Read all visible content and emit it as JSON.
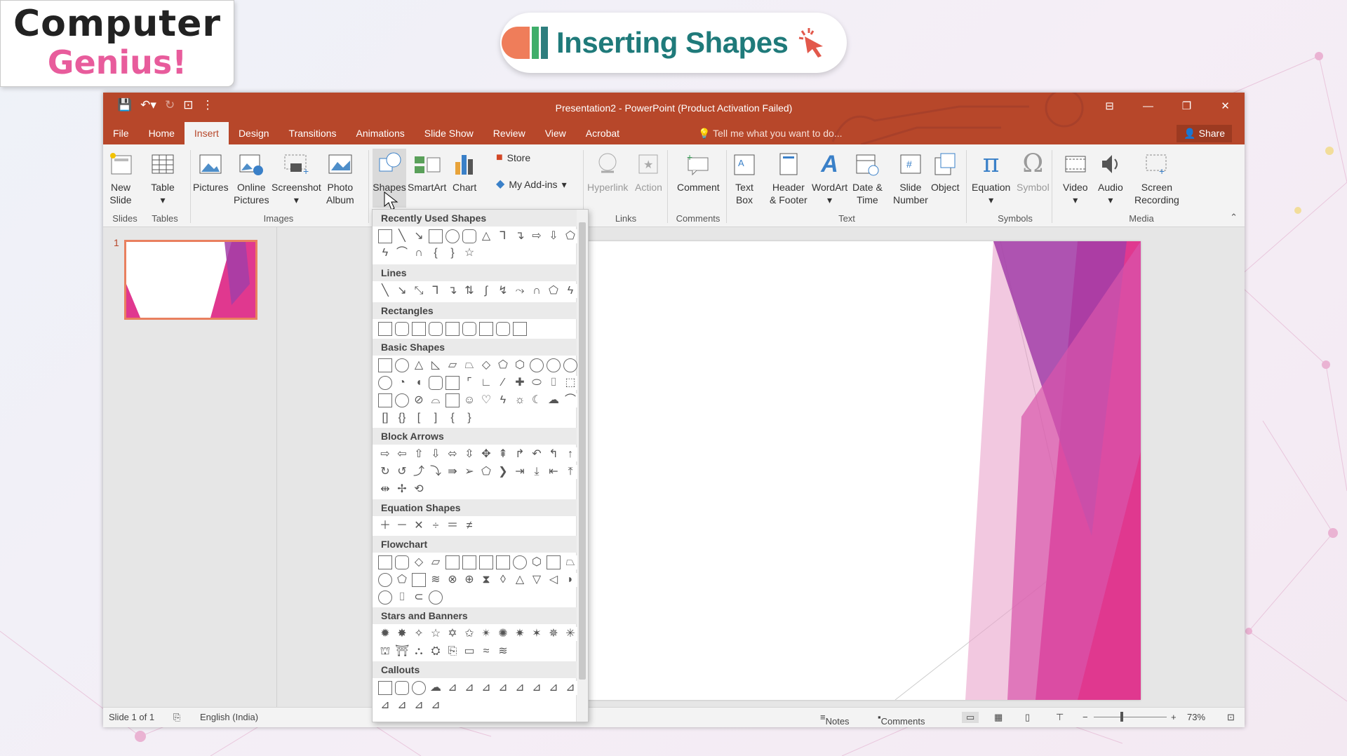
{
  "brand": {
    "line1": "Computer",
    "line2": "Genius!"
  },
  "banner": {
    "title": "Inserting Shapes",
    "icon": "cursor-click-icon"
  },
  "app": {
    "window_title": "Presentation2 - PowerPoint (Product Activation Failed)",
    "tabs": [
      "File",
      "Home",
      "Insert",
      "Design",
      "Transitions",
      "Animations",
      "Slide Show",
      "Review",
      "View",
      "Acrobat"
    ],
    "active_tab": "Insert",
    "tell_me": "Tell me what you want to do...",
    "share": "Share",
    "ribbon": {
      "new_slide": [
        "New",
        "Slide"
      ],
      "table": "Table",
      "pictures": "Pictures",
      "online_pictures": [
        "Online",
        "Pictures"
      ],
      "screenshot": "Screenshot",
      "photo_album": [
        "Photo",
        "Album"
      ],
      "shapes": "Shapes",
      "smartart": "SmartArt",
      "chart": "Chart",
      "store": "Store",
      "my_addins": "My Add-ins",
      "hyperlink": "Hyperlink",
      "action": "Action",
      "comment": "Comment",
      "text_box": [
        "Text",
        "Box"
      ],
      "header_footer": [
        "Header",
        "& Footer"
      ],
      "wordart": "WordArt",
      "date_time": [
        "Date &",
        "Time"
      ],
      "slide_number": [
        "Slide",
        "Number"
      ],
      "object": "Object",
      "equation": "Equation",
      "symbol": "Symbol",
      "video": "Video",
      "audio": "Audio",
      "screen_recording": [
        "Screen",
        "Recording"
      ],
      "groups": {
        "slides": "Slides",
        "tables": "Tables",
        "images": "Images",
        "links": "Links",
        "comments": "Comments",
        "text": "Text",
        "symbols": "Symbols",
        "media": "Media"
      }
    },
    "slide_number": "1",
    "shapes_gallery": {
      "sections": [
        "Recently Used Shapes",
        "Lines",
        "Rectangles",
        "Basic Shapes",
        "Block Arrows",
        "Equation Shapes",
        "Flowchart",
        "Stars and Banners",
        "Callouts"
      ]
    },
    "status": {
      "slide": "Slide 1 of 1",
      "language": "English (India)",
      "notes": "Notes",
      "comments": "Comments",
      "zoom": "73%"
    }
  },
  "colors": {
    "accent": "#b7472a",
    "slide_pink": "#e0388f",
    "slide_purple": "#a23ea8",
    "title_teal": "#1f7a7a"
  }
}
